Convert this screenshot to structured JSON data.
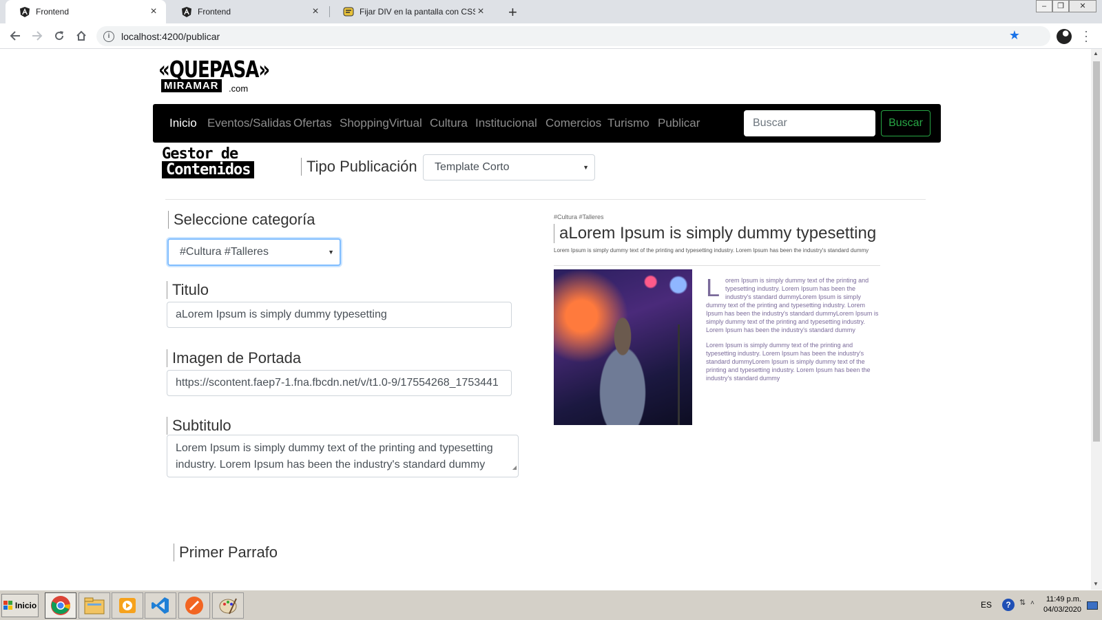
{
  "browser": {
    "tabs": [
      {
        "title": "Frontend",
        "icon": "angular-icon",
        "active": true
      },
      {
        "title": "Frontend",
        "icon": "angular-icon",
        "active": false
      },
      {
        "title": "Fijar DIV en la pantalla con CSS - Fo",
        "icon": "forum-icon",
        "active": false
      }
    ],
    "url": "localhost:4200/publicar",
    "new_tab": "+"
  },
  "site": {
    "logo": {
      "line1": "«QUEPASA»",
      "line2": "MIRAMAR",
      "line3": ".com"
    },
    "nav": [
      "Inicio",
      "Eventos/Salidas",
      "Ofertas",
      "ShoppingVirtual",
      "Cultura",
      "Institucional",
      "Comercios",
      "Turismo",
      "Publicar"
    ],
    "search_placeholder": "Buscar",
    "search_button": "Buscar"
  },
  "editor": {
    "gestor_line1": "Gestor de",
    "gestor_line2": "Contenidos",
    "tipo_label": "Tipo Publicación",
    "tipo_value": "Template Corto",
    "categoria_label": "Seleccione categoría",
    "categoria_value": "#Cultura #Talleres",
    "titulo_label": "Titulo",
    "titulo_value": "aLorem Ipsum is simply dummy typesetting",
    "imagen_label": "Imagen de Portada",
    "imagen_value": "https://scontent.faep7-1.fna.fbcdn.net/v/t1.0-9/17554268_1753441",
    "subtitulo_label": "Subtitulo",
    "subtitulo_value": "Lorem Ipsum is simply dummy text of the printing and typesetting industry. Lorem Ipsum has been the industry's standard dummy",
    "parrafo_label": "Primer Parrafo"
  },
  "preview": {
    "tags": "#Cultura #Talleres",
    "title": "aLorem Ipsum is simply dummy typesetting",
    "subtitle": "Lorem Ipsum is simply dummy text of the printing and typesetting industry. Lorem Ipsum has been the industry's standard dummy",
    "drop_cap": "L",
    "para1": "orem Ipsum is simply dummy text of the printing and typesetting industry. Lorem Ipsum has been the industry's standard dummyLorem Ipsum is simply dummy text of the printing and typesetting industry. Lorem Ipsum has been the industry's standard dummyLorem Ipsum is simply dummy text of the printing and typesetting industry. Lorem Ipsum has been the industry's standard dummy",
    "para2": "Lorem Ipsum is simply dummy text of the printing and typesetting industry. Lorem Ipsum has been the industry's standard dummyLorem Ipsum is simply dummy text of the printing and typesetting industry. Lorem Ipsum has been the industry's standard dummy"
  },
  "taskbar": {
    "start": "Inicio",
    "apps": [
      "chrome-icon",
      "file-explorer-icon",
      "media-player-icon",
      "vscode-icon",
      "sublime-icon",
      "paint-icon"
    ],
    "lang": "ES",
    "time": "11:49 p.m.",
    "date": "04/03/2020"
  },
  "colors": {
    "nav_bg": "#000000",
    "accent_green": "#28a745",
    "focus_blue": "#80bdff",
    "chrome_blue": "#1a73e8"
  }
}
